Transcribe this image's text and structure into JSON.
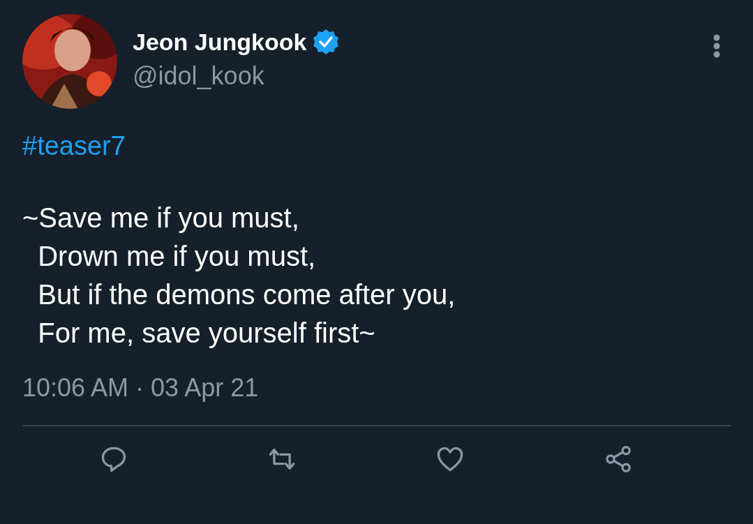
{
  "tweet": {
    "author": {
      "name": "Jeon Jungkook",
      "verified": true,
      "handle": "@idol_kook"
    },
    "hashtag": "#teaser7",
    "text": "~Save me if you must,\n  Drown me if you must,\n  But if the demons come after you,\n  For me, save yourself first~",
    "timestamp": "10:06 AM · 03 Apr 21",
    "actions": [
      {
        "kind": "reply"
      },
      {
        "kind": "retweet"
      },
      {
        "kind": "like"
      },
      {
        "kind": "share"
      }
    ]
  }
}
